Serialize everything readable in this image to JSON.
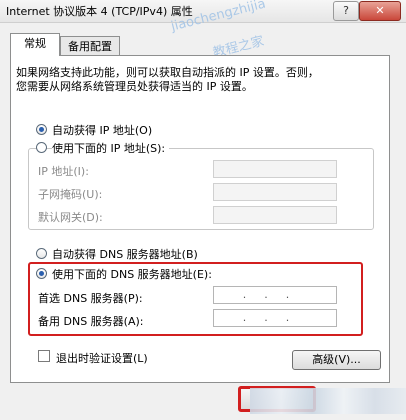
{
  "window": {
    "title": "Internet 协议版本 4 (TCP/IPv4) 属性",
    "help_label": "?",
    "close_label": "✕"
  },
  "tabs": [
    {
      "label": "常规"
    },
    {
      "label": "备用配置"
    }
  ],
  "watermark": {
    "line1": "jiaochengzhijia",
    "line2": "教程之家"
  },
  "description": {
    "line1": "如果网络支持此功能，则可以获取自动指派的 IP 设置。否则，",
    "line2": "您需要从网络系统管理员处获得适当的 IP 设置。"
  },
  "ip": {
    "auto_label": "自动获得 IP 地址(O)",
    "manual_label": "使用下面的 IP 地址(S):",
    "auto_checked": true,
    "address_label": "IP 地址(I):",
    "mask_label": "子网掩码(U):",
    "gateway_label": "默认网关(D):"
  },
  "dns": {
    "auto_label": "自动获得 DNS 服务器地址(B)",
    "manual_label": "使用下面的 DNS 服务器地址(E):",
    "manual_checked": true,
    "preferred_label": "首选 DNS 服务器(P):",
    "alternate_label": "备用 DNS 服务器(A):",
    "preferred_value": "...",
    "alternate_value": "..."
  },
  "footer": {
    "validate_label": "退出时验证设置(L)",
    "advanced_label": "高级(V)..."
  },
  "colors": {
    "highlight": "#d21f1f",
    "radio_fill": "#2a5fae"
  }
}
